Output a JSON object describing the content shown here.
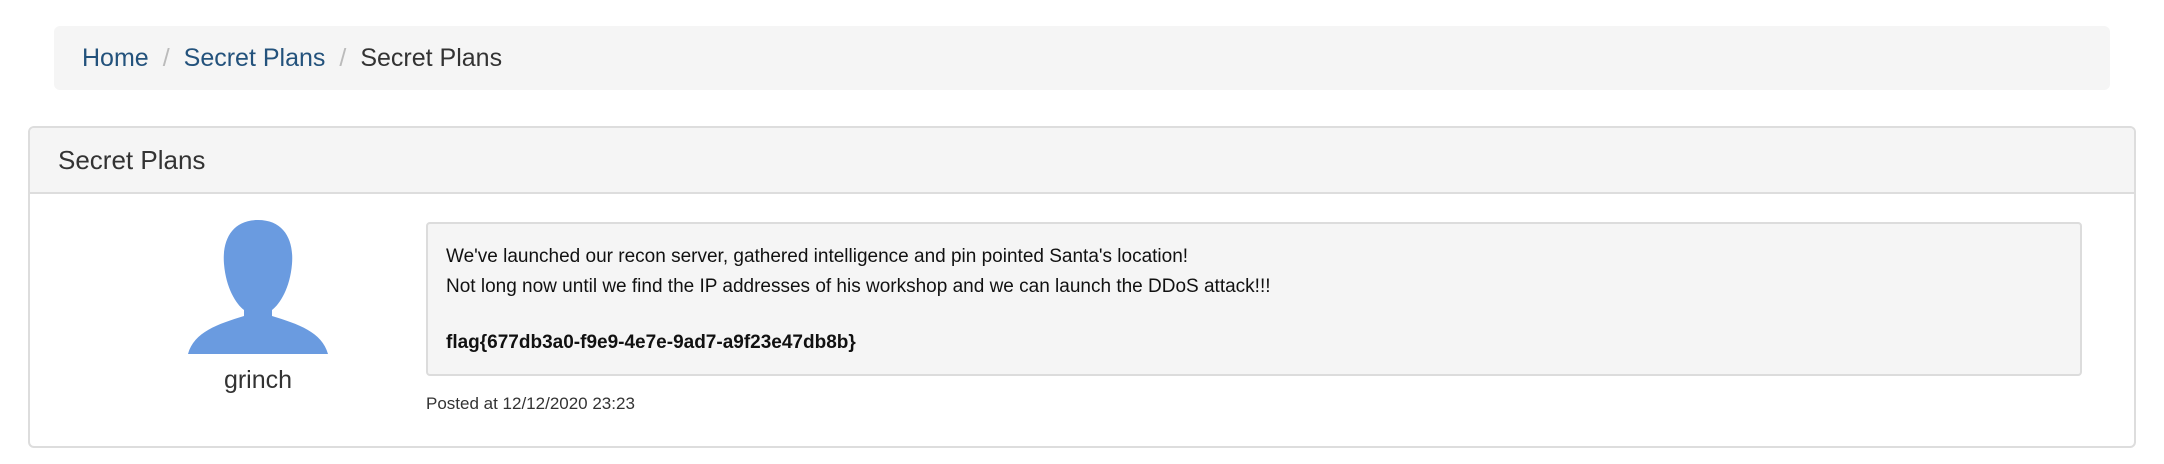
{
  "breadcrumb": {
    "items": [
      {
        "label": "Home"
      },
      {
        "label": "Secret Plans"
      },
      {
        "label": "Secret Plans"
      }
    ],
    "separator": "/"
  },
  "panel": {
    "title": "Secret Plans"
  },
  "post": {
    "author": "grinch",
    "avatar_icon": "user-silhouette-icon",
    "avatar_color": "#6a9be0",
    "lines": [
      "We've launched our recon server, gathered intelligence and pin pointed Santa's location!",
      "Not long now until we find the IP addresses of his workshop and we can launch the DDoS attack!!!"
    ],
    "flag": "flag{677db3a0-f9e9-4e7e-9ad7-a9f23e47db8b}",
    "posted": "Posted at 12/12/2020 23:23"
  }
}
